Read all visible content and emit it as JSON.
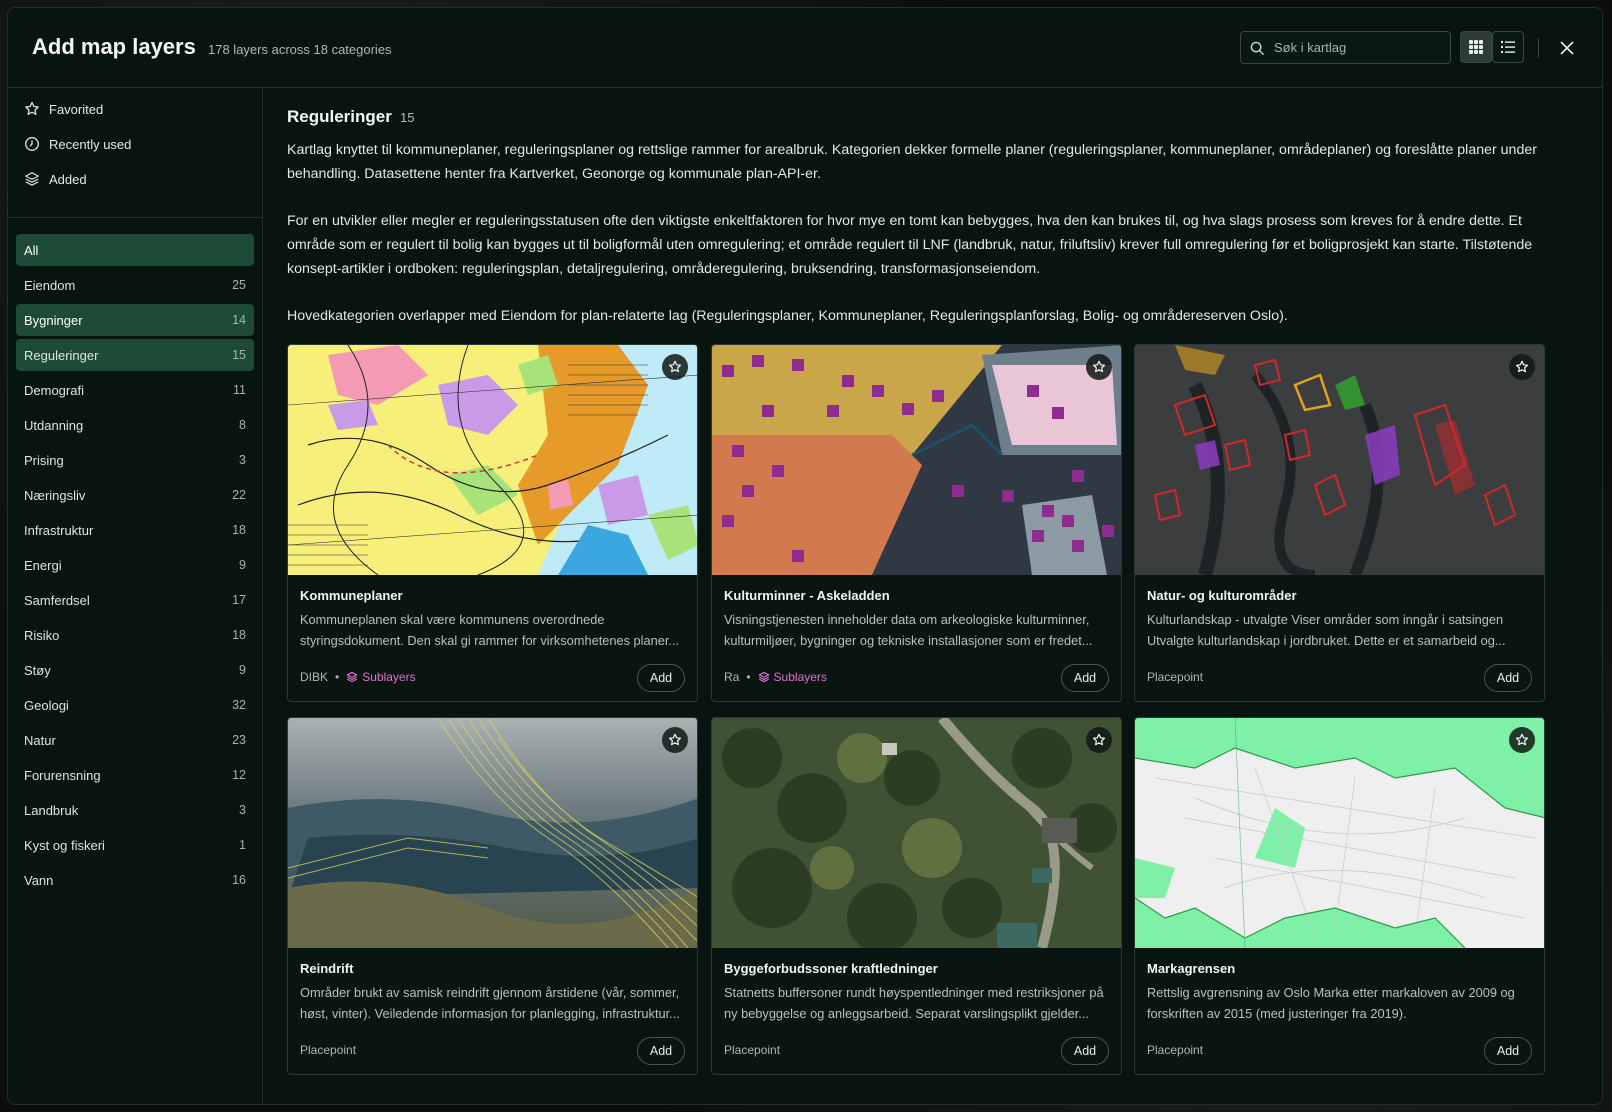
{
  "header": {
    "title": "Add map layers",
    "subtitle": "178 layers across 18 categories",
    "search_placeholder": "Søk i kartlag"
  },
  "sidebar": {
    "quick": [
      {
        "label": "Favorited",
        "icon": "star-icon"
      },
      {
        "label": "Recently used",
        "icon": "clock-icon"
      },
      {
        "label": "Added",
        "icon": "layers-icon"
      }
    ],
    "categories": [
      {
        "label": "All",
        "count": ""
      },
      {
        "label": "Eiendom",
        "count": "25"
      },
      {
        "label": "Bygninger",
        "count": "14"
      },
      {
        "label": "Reguleringer",
        "count": "15"
      },
      {
        "label": "Demografi",
        "count": "11"
      },
      {
        "label": "Utdanning",
        "count": "8"
      },
      {
        "label": "Prising",
        "count": "3"
      },
      {
        "label": "Næringsliv",
        "count": "22"
      },
      {
        "label": "Infrastruktur",
        "count": "18"
      },
      {
        "label": "Energi",
        "count": "9"
      },
      {
        "label": "Samferdsel",
        "count": "17"
      },
      {
        "label": "Risiko",
        "count": "18"
      },
      {
        "label": "Støy",
        "count": "9"
      },
      {
        "label": "Geologi",
        "count": "32"
      },
      {
        "label": "Natur",
        "count": "23"
      },
      {
        "label": "Forurensning",
        "count": "12"
      },
      {
        "label": "Landbruk",
        "count": "3"
      },
      {
        "label": "Kyst og fiskeri",
        "count": "1"
      },
      {
        "label": "Vann",
        "count": "16"
      }
    ]
  },
  "main": {
    "category_title": "Reguleringer",
    "category_count": "15",
    "description": [
      "Kartlag knyttet til kommuneplaner, reguleringsplaner og rettslige rammer for arealbruk. Kategorien dekker formelle planer (reguleringsplaner, kommuneplaner, områdeplaner) og foreslåtte planer under behandling. Datasettene henter fra Kartverket, Geonorge og kommunale plan-API-er.",
      "For en utvikler eller megler er reguleringsstatusen ofte den viktigste enkeltfaktoren for hvor mye en tomt kan bebygges, hva den kan brukes til, og hva slags prosess som kreves for å endre dette. Et område som er regulert til bolig kan bygges ut til boligformål uten omregulering; et område regulert til LNF (landbruk, natur, friluftsliv) krever full omregulering før et boligprosjekt kan starte. Tilstøtende konsept-artikler i ordboken: reguleringsplan, detaljregulering, områderegulering, bruksendring, transformasjonseiendom.",
      "Hovedkategorien overlapper med Eiendom for plan-relaterte lag (Reguleringsplaner, Kommuneplaner, Reguleringsplanforslag, Bolig- og områdereserven Oslo)."
    ],
    "cards": [
      {
        "title": "Kommuneplaner",
        "desc": "Kommuneplanen skal være kommunens overordnede styringsdokument. Den skal gi rammer for virksomhetenes planer...",
        "source": "DIBK",
        "sublayers": "Sublayers",
        "add": "Add"
      },
      {
        "title": "Kulturminner - Askeladden",
        "desc": "Visningstjenesten inneholder data om arkeologiske kulturminner, kulturmiljøer, bygninger og tekniske installasjoner som er fredet...",
        "source": "Ra",
        "sublayers": "Sublayers",
        "add": "Add"
      },
      {
        "title": "Natur- og kulturområder",
        "desc": "Kulturlandskap - utvalgte Viser områder som inngår i satsingen Utvalgte kulturlandskap i jordbruket. Dette er et samarbeid og...",
        "source": "Placepoint",
        "sublayers": "",
        "add": "Add"
      },
      {
        "title": "Reindrift",
        "desc": "Områder brukt av samisk reindrift gjennom årstidene (vår, sommer, høst, vinter). Veiledende informasjon for planlegging, infrastruktur...",
        "source": "Placepoint",
        "sublayers": "",
        "add": "Add"
      },
      {
        "title": "Byggeforbudssoner kraftledninger",
        "desc": "Statnetts buffersoner rundt høyspentledninger med restriksjoner på ny bebyggelse og anleggsarbeid. Separat varslingsplikt gjelder...",
        "source": "Placepoint",
        "sublayers": "",
        "add": "Add"
      },
      {
        "title": "Markagrensen",
        "desc": "Rettslig avgrensning av Oslo Marka etter markaloven av 2009 og forskriften av 2015 (med justeringer fra 2019).",
        "source": "Placepoint",
        "sublayers": "",
        "add": "Add"
      }
    ]
  },
  "colors": {
    "accent": "#1d4b37",
    "sublayer": "#e86fcf",
    "background": "#071410"
  }
}
